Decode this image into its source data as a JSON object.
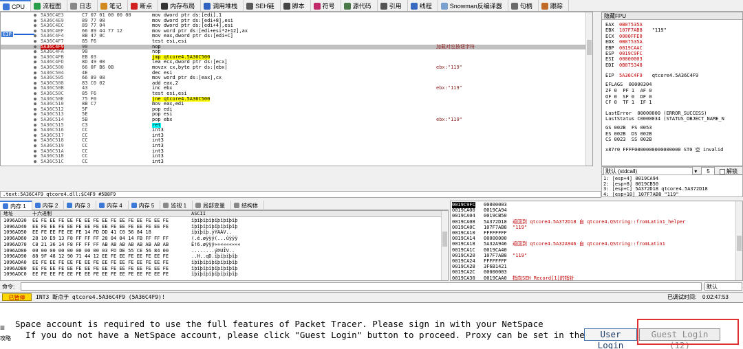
{
  "tabs": [
    {
      "label": "CPU",
      "icon": "cpu-icon",
      "color": "#3c78d8"
    },
    {
      "label": "流程图",
      "icon": "flowchart-icon",
      "color": "#2a9d4b"
    },
    {
      "label": "日志",
      "icon": "log-icon",
      "color": "#888888"
    },
    {
      "label": "笔记",
      "icon": "notes-icon",
      "color": "#d08a20"
    },
    {
      "label": "断点",
      "icon": "breakpoint-icon",
      "color": "#d02020"
    },
    {
      "label": "内存布局",
      "icon": "memory-map-icon",
      "color": "#333333"
    },
    {
      "label": "调用堆栈",
      "icon": "callstack-icon",
      "color": "#3060c0"
    },
    {
      "label": "SEH链",
      "icon": "seh-icon",
      "color": "#5a5a5a"
    },
    {
      "label": "脚本",
      "icon": "script-icon",
      "color": "#444444"
    },
    {
      "label": "符号",
      "icon": "symbol-icon",
      "color": "#c02a6a"
    },
    {
      "label": "源代码",
      "icon": "source-icon",
      "color": "#4a7a4a"
    },
    {
      "label": "引用",
      "icon": "reference-icon",
      "color": "#555555"
    },
    {
      "label": "线程",
      "icon": "thread-icon",
      "color": "#3a6ac0"
    },
    {
      "label": "Snowman反编译器",
      "icon": "snowman-icon",
      "color": "#7aa0d0"
    },
    {
      "label": "句柄",
      "icon": "handle-icon",
      "color": "#6a6a6a"
    },
    {
      "label": "跟踪",
      "icon": "trace-icon",
      "color": "#c06a2a"
    }
  ],
  "eip_label": "EIP",
  "disasm": [
    {
      "addr": "5A36C4E3",
      "bytes": "C7 07 01 00 00 00",
      "inst": "mov dword ptr ds:[edi],1",
      "cmt": ""
    },
    {
      "addr": "5A36C4E9",
      "bytes": "89 77 08",
      "inst": "mov dword ptr ds:[edi+8],esi",
      "cmt": ""
    },
    {
      "addr": "5A36C4EC",
      "bytes": "89 77 04",
      "inst": "mov dword ptr ds:[edi+4],esi",
      "cmt": ""
    },
    {
      "addr": "5A36C4EF",
      "bytes": "66 89 44 77 12",
      "inst": "mov word ptr ds:[edi+esi*2+12],ax",
      "cmt": ""
    },
    {
      "addr": "5A36C4F4",
      "bytes": "8B 47 0C",
      "inst": "mov eax,dword ptr ds:[edi+C]",
      "cmt": ""
    },
    {
      "addr": "5A36C4F7",
      "bytes": "85 F6",
      "inst": "test esi,esi",
      "cmt": ""
    },
    {
      "addr": "5A36C4F9",
      "bytes": "90",
      "inst": "nop",
      "cmt": "加载对应按钮字符",
      "eip": true
    },
    {
      "addr": "5A36C4FA",
      "bytes": "90",
      "inst": "nop",
      "cmt": ""
    },
    {
      "addr": "5A36C4FB",
      "bytes": "EB 03",
      "inst": "jmp qtcore4.5A36C500",
      "cmt": "",
      "hl": "yellow"
    },
    {
      "addr": "5A36C4FD",
      "bytes": "8D 49 00",
      "inst": "lea ecx,dword ptr ds:[ecx]",
      "cmt": ""
    },
    {
      "addr": "5A36C500",
      "bytes": "66 0F B6 0B",
      "inst": "movzx cx,byte ptr ds:[ebx]",
      "cmt": "ebx:\"119\""
    },
    {
      "addr": "5A36C504",
      "bytes": "4E",
      "inst": "dec esi",
      "cmt": ""
    },
    {
      "addr": "5A36C505",
      "bytes": "66 89 08",
      "inst": "mov word ptr ds:[eax],cx",
      "cmt": ""
    },
    {
      "addr": "5A36C508",
      "bytes": "83 C0 02",
      "inst": "add eax,2",
      "cmt": ""
    },
    {
      "addr": "5A36C50B",
      "bytes": "43",
      "inst": "inc ebx",
      "cmt": "ebx:\"119\""
    },
    {
      "addr": "5A36C50C",
      "bytes": "85 F6",
      "inst": "test esi,esi",
      "cmt": ""
    },
    {
      "addr": "5A36C50E",
      "bytes": "75 F0",
      "inst": "jne qtcore4.5A36C500",
      "cmt": "",
      "hl": "yellow"
    },
    {
      "addr": "5A36C510",
      "bytes": "8B C7",
      "inst": "mov eax,edi",
      "cmt": ""
    },
    {
      "addr": "5A36C512",
      "bytes": "5F",
      "inst": "pop edi",
      "cmt": ""
    },
    {
      "addr": "5A36C513",
      "bytes": "5E",
      "inst": "pop esi",
      "cmt": ""
    },
    {
      "addr": "5A36C514",
      "bytes": "5B",
      "inst": "pop ebx",
      "cmt": "ebx:\"119\""
    },
    {
      "addr": "5A36C515",
      "bytes": "C3",
      "inst": "ret",
      "cmt": "",
      "hl": "cyan"
    },
    {
      "addr": "5A36C516",
      "bytes": "CC",
      "inst": "int3",
      "cmt": ""
    },
    {
      "addr": "5A36C517",
      "bytes": "CC",
      "inst": "int3",
      "cmt": ""
    },
    {
      "addr": "5A36C518",
      "bytes": "CC",
      "inst": "int3",
      "cmt": ""
    },
    {
      "addr": "5A36C519",
      "bytes": "CC",
      "inst": "int3",
      "cmt": ""
    },
    {
      "addr": "5A36C51A",
      "bytes": "CC",
      "inst": "int3",
      "cmt": ""
    },
    {
      "addr": "5A36C51B",
      "bytes": "CC",
      "inst": "int3",
      "cmt": ""
    },
    {
      "addr": "5A36C51C",
      "bytes": "CC",
      "inst": "int3",
      "cmt": ""
    }
  ],
  "fpu": {
    "title": "隐藏FPU",
    "regs": [
      {
        "n": "EAX",
        "v": "0B07535A",
        "c": ""
      },
      {
        "n": "EBX",
        "v": "107F7AB8",
        "c": "\"119\""
      },
      {
        "n": "ECX",
        "v": "0000FFE0",
        "c": ""
      },
      {
        "n": "EDX",
        "v": "0B07535A",
        "c": ""
      },
      {
        "n": "EBP",
        "v": "0019CAAC",
        "c": ""
      },
      {
        "n": "ESP",
        "v": "0019C9FC",
        "c": ""
      },
      {
        "n": "ESI",
        "v": "00000003",
        "c": ""
      },
      {
        "n": "EDI",
        "v": "0B075348",
        "c": ""
      }
    ],
    "eip": {
      "n": "EIP",
      "v": "5A36C4F9",
      "c": "qtcore4.5A36C4F9"
    },
    "eflags": "EFLAGS  00000304",
    "flags": [
      "ZF 0  PF 1  AF 0",
      "OF 0  SF 0  DF 0",
      "CF 0  TF 1  IF 1"
    ],
    "lasterror": "LastError  00000000 (ERROR_SUCCESS)",
    "laststatus": "LastStatus C0000034 (STATUS_OBJECT_NAME_N",
    "segs": [
      "GS 002B  FS 0053",
      "ES 002B  DS 002B",
      "CS 0023  SS 002B"
    ],
    "x87": "x87r0 FFFF0000000000000000 ST0 空 invalid"
  },
  "callconv": {
    "label": "默认 (stdcall)",
    "count": "5",
    "unlock": "解锁"
  },
  "stackargs": [
    "1: [esp+4] 0019CA94",
    "2: [esp+8] 0019CB50",
    "3: [esp+C] 5A372D18 qtcore4.5A372D18",
    "4: [esp+10] 107F7AB8 \"119\""
  ],
  "statusline": ".text:5A36C4F9 qtcore4.dll:$C4F9 #5B8F9",
  "memtabs": [
    {
      "label": "内存 1",
      "icon": "memory-icon"
    },
    {
      "label": "内存 2",
      "icon": "memory-icon"
    },
    {
      "label": "内存 3",
      "icon": "memory-icon"
    },
    {
      "label": "内存 4",
      "icon": "memory-icon"
    },
    {
      "label": "内存 5",
      "icon": "memory-icon"
    },
    {
      "label": "监视 1",
      "icon": "watch-icon"
    },
    {
      "label": "局部变量",
      "icon": "locals-icon"
    },
    {
      "label": "结构体",
      "icon": "struct-icon"
    }
  ],
  "hex": {
    "headers": [
      "地址",
      "十六进制",
      "ASCII"
    ],
    "rows": [
      {
        "a": "1096AD30",
        "h": "EE FE EE FE EE FE EE FE EE FE EE FE EE FE EE FE",
        "s": "îþîþîþîþîþîþîþîþ"
      },
      {
        "a": "1096AD40",
        "h": "EE FE EE FE EE FE EE FE EE FE EE FE EE FE EE FE",
        "s": "îþîþîþîþîþîþîþîþ"
      },
      {
        "a": "1096AD50",
        "h": "EE FE EE FE EE FE 14 FD DD 41 C0 56 84 18",
        "s": "îþîþîþ.ýÝAÀV.."
      },
      {
        "a": "1096AD60",
        "h": "28 10 E9 13 F8 FF FF FF 28 04 04 14 FB FF FF FF",
        "s": "(.é.øÿÿÿ(...ûÿÿÿ"
      },
      {
        "a": "1096AD70",
        "h": "C8 21 36 14 F8 FF FF FF AB AB AB AB AB AB AB AB",
        "s": "È!6.øÿÿÿ«««««««««"
      },
      {
        "a": "1096AD80",
        "h": "00 00 00 00 00 00 00 00 03 FD DE 55 CE 56 84 00",
        "s": "........ýÞUÎV.."
      },
      {
        "a": "1096AD90",
        "h": "88 9F 48 12 90 71 44 12 EE FE EE FE EE FE EE FE",
        "s": "..H..qD.îþîþîþîþ"
      },
      {
        "a": "1096ADA0",
        "h": "EE FE EE FE EE FE EE FE EE FE EE FE EE FE EE FE",
        "s": "îþîþîþîþîþîþîþîþ"
      },
      {
        "a": "1096ADB0",
        "h": "EE FE EE FE EE FE EE FE EE FE EE FE EE FE EE FE",
        "s": "îþîþîþîþîþîþîþîþ"
      },
      {
        "a": "1096ADC0",
        "h": "EE FE EE FE EE FE EE FE EE FE EE FE EE FE EE FE",
        "s": "îþîþîþîþîþîþîþîþ"
      }
    ]
  },
  "stack": [
    {
      "a": "0019C9FC",
      "v": "00000003",
      "c": "",
      "sel": true
    },
    {
      "a": "0019CA00",
      "v": "0019CA94",
      "c": ""
    },
    {
      "a": "0019CA04",
      "v": "0019CB50",
      "c": ""
    },
    {
      "a": "0019CA08",
      "v": "5A372D18",
      "c": "返回到 qtcore4.5A372D18 自 qtcore4.QString::fromLatin1_helper"
    },
    {
      "a": "0019CA0C",
      "v": "107F7AB8",
      "c": "\"119\""
    },
    {
      "a": "0019CA10",
      "v": "FFFFFFFF",
      "c": ""
    },
    {
      "a": "0019CA14",
      "v": "00000000",
      "c": ""
    },
    {
      "a": "0019CA18",
      "v": "5A32A946",
      "c": "返回到 qtcore4.5A32A946 自 qtcore4.QString::fromLatin1"
    },
    {
      "a": "0019CA1C",
      "v": "0019CA40",
      "c": ""
    },
    {
      "a": "0019CA20",
      "v": "107F7AB8",
      "c": "\"119\""
    },
    {
      "a": "0019CA24",
      "v": "FFFFFFFF",
      "c": ""
    },
    {
      "a": "0019CA28",
      "v": "3F6B1421",
      "c": ""
    },
    {
      "a": "0019CA2C",
      "v": "00000003",
      "c": ""
    },
    {
      "a": "0019CA30",
      "v": "0019CAA0",
      "c": "指向SEH_Record[1]的指针"
    }
  ],
  "cmd": {
    "label": "命令:",
    "default": "默认"
  },
  "status": {
    "paused": "已暂停",
    "msg": "INT3 断点于 qtcore4.5A36C4F9 (5A36C4F9)!",
    "timelabel": "已调试时间:",
    "time": "0:02:47:53"
  },
  "pt": {
    "line1": "Space account is required to use the full features of Packet Tracer. Please sign in with your NetSpace",
    "line2": "  If you do not have a NetSpace account, please click \"Guest Login\" button to proceed. Proxy can be set in the",
    "side_top": "≡",
    "side_bottom": "攻略",
    "user_login": "User Login",
    "guest_login": "Guest Login (12)"
  }
}
